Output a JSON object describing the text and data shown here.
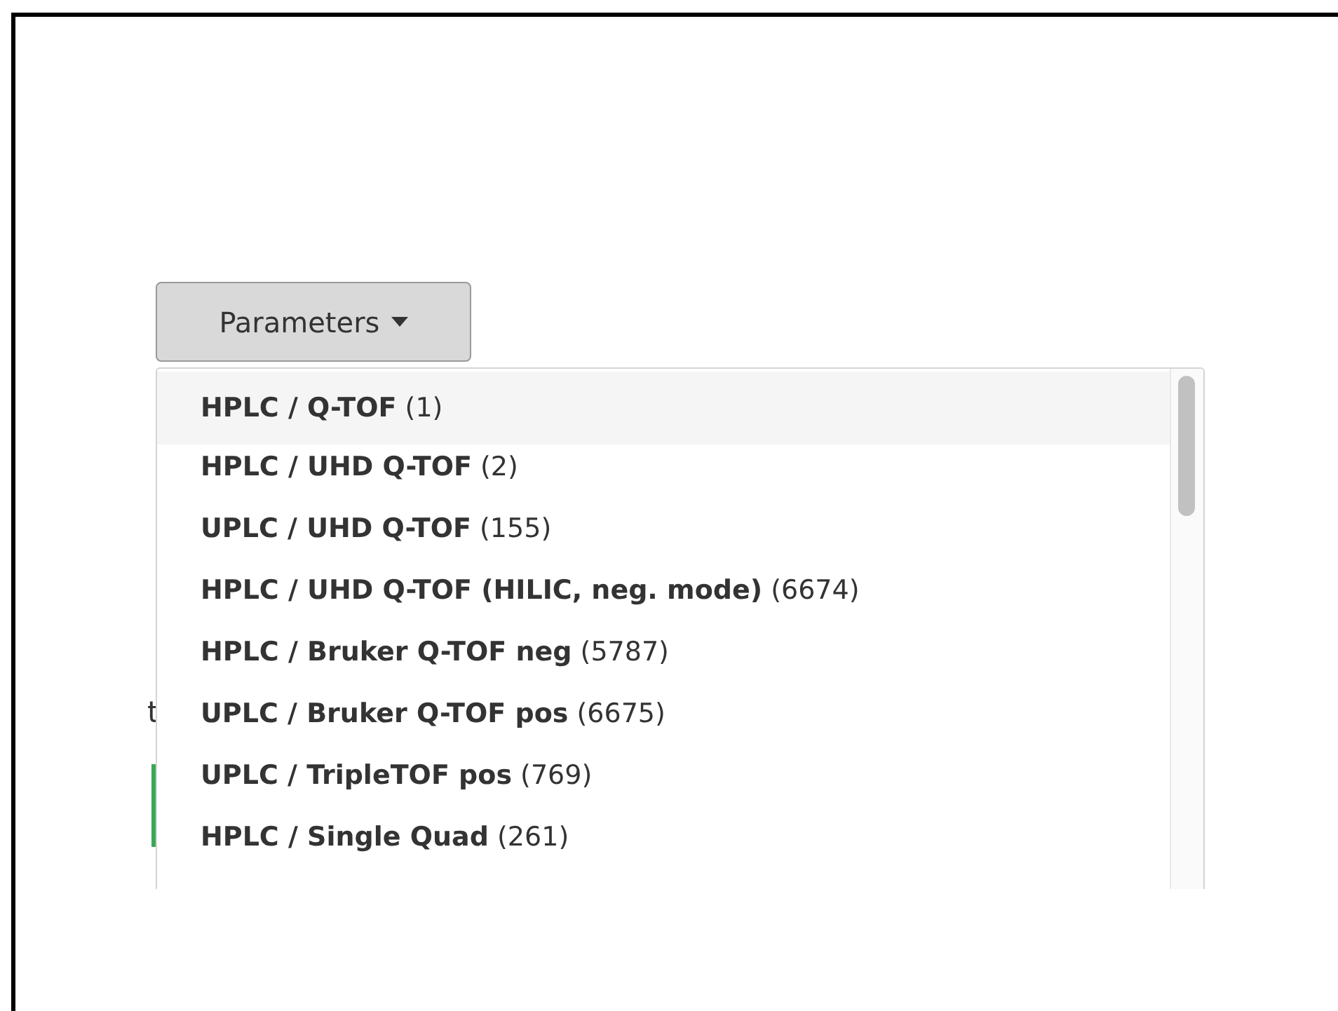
{
  "dropdown_button": {
    "label": "Parameters",
    "expanded": true
  },
  "background_text": "t",
  "menu": {
    "items": [
      {
        "name": "HPLC / Q-TOF",
        "count": "(1)",
        "selected": true
      },
      {
        "name": "HPLC / UHD Q-TOF",
        "count": "(2)",
        "selected": false
      },
      {
        "name": "UPLC / UHD Q-TOF",
        "count": "(155)",
        "selected": false
      },
      {
        "name": "HPLC / UHD Q-TOF (HILIC, neg. mode)",
        "count": "(6674)",
        "selected": false
      },
      {
        "name": "HPLC / Bruker Q-TOF neg",
        "count": "(5787)",
        "selected": false
      },
      {
        "name": "UPLC / Bruker Q-TOF pos",
        "count": "(6675)",
        "selected": false
      },
      {
        "name": "UPLC / TripleTOF pos",
        "count": "(769)",
        "selected": false
      },
      {
        "name": "HPLC / Single Quad",
        "count": "(261)",
        "selected": false
      }
    ]
  }
}
